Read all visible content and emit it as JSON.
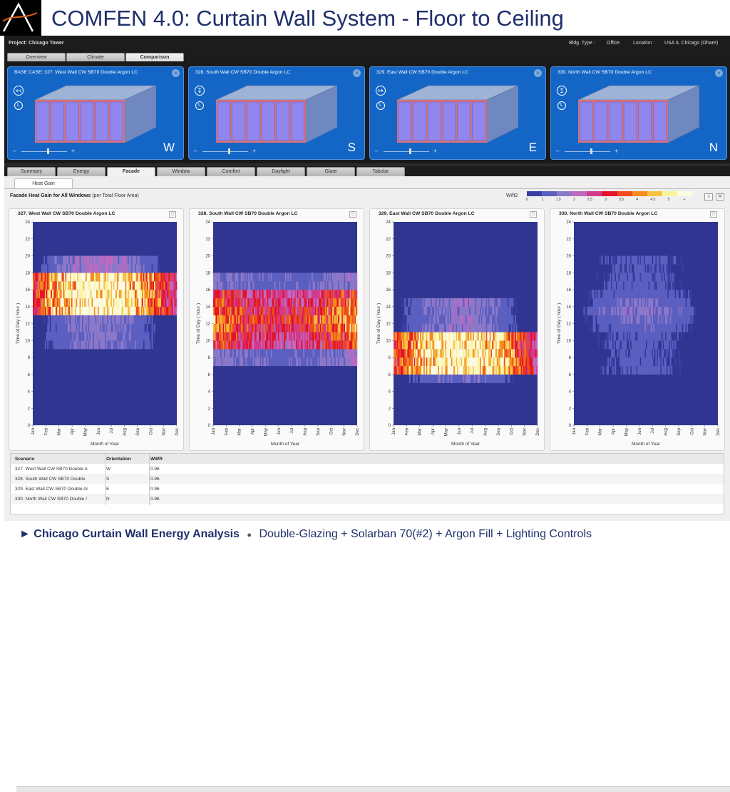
{
  "slide_title": "COMFEN 4.0:  Curtain Wall System - Floor to Ceiling",
  "project_bar": {
    "project": "Project: Chicago Tower",
    "bldg_type_label": "Bldg. Type :",
    "bldg_type_value": "Office",
    "location_label": "Location :",
    "location_value": "USA IL Chicago (Ohare)"
  },
  "top_tabs": [
    "Overview",
    "Climate",
    "Comparison"
  ],
  "cards": [
    {
      "title": "BASE CASE: 327. West Wall CW SB70 Double Argon LC",
      "orientation": "W"
    },
    {
      "title": "328. South Wall CW SB70 Double Argon LC",
      "orientation": "S"
    },
    {
      "title": "329. East Wall CW SB70 Double Argon LC",
      "orientation": "E"
    },
    {
      "title": "330. North Wall CW SB70 Double Argon LC",
      "orientation": "N"
    }
  ],
  "card_controls": {
    "compass_l": "L",
    "zoom_minus": "–",
    "zoom_plus": "+",
    "close": "×"
  },
  "sub_tabs": [
    "Summary",
    "Energy",
    "Facade",
    "Window",
    "Comfort",
    "Daylight",
    "Glare",
    "Tabular"
  ],
  "active_sub_tab": "Facade",
  "heat_gain_tab": "Heat Gain",
  "heading_bold": "Facade Heat Gain for All Windows",
  "heading_rest": "(per Total Floor Area)",
  "legend": {
    "unit": "W/ft2",
    "ticks": [
      "0",
      "1",
      "1.5",
      "2",
      "2.5",
      "3",
      "3.5",
      "4",
      "4.5",
      "5",
      "+"
    ],
    "colors": [
      "#3a3fa6",
      "#5b5fc0",
      "#8b78c9",
      "#bf6ac2",
      "#d43a8c",
      "#e5132b",
      "#ef4d1d",
      "#f58a1f",
      "#f7c144",
      "#fbf3a0",
      "#fdfbe0"
    ]
  },
  "chart_data": [
    {
      "type": "heatmap",
      "title": "327. West Wall CW SB70 Double Argon LC",
      "xlabel": "Month of Year",
      "ylabel": "Time of Day ( hour )",
      "x_categories": [
        "Jan",
        "Feb",
        "Mar",
        "Apr",
        "May",
        "Jun",
        "Jul",
        "Aug",
        "Sep",
        "Oct",
        "Nov",
        "Dec"
      ],
      "y_ticks": [
        0,
        2,
        4,
        6,
        8,
        10,
        12,
        14,
        16,
        18,
        20,
        24,
        22
      ],
      "ylim": [
        0,
        24
      ],
      "peak_hours": [
        14,
        17
      ],
      "orientation": "W"
    },
    {
      "type": "heatmap",
      "title": "328. South Wall CW SB70 Double Argon LC",
      "xlabel": "Month of Year",
      "ylabel": "Time of Day ( hour )",
      "x_categories": [
        "Jan",
        "Feb",
        "Mar",
        "Apr",
        "May",
        "Jun",
        "Jul",
        "Aug",
        "Sep",
        "Oct",
        "Nov",
        "Dec"
      ],
      "y_ticks": [
        0,
        2,
        4,
        6,
        8,
        10,
        12,
        14,
        16,
        18,
        20,
        22,
        24
      ],
      "ylim": [
        0,
        24
      ],
      "peak_hours": [
        9,
        15
      ],
      "orientation": "S"
    },
    {
      "type": "heatmap",
      "title": "329. East Wall CW SB70 Double Argon LC",
      "xlabel": "Month of Year",
      "ylabel": "Time of Day ( hour )",
      "x_categories": [
        "Jan",
        "Feb",
        "Mar",
        "Apr",
        "May",
        "Jun",
        "Jul",
        "Aug",
        "Sep",
        "Oct",
        "Nov",
        "Dec"
      ],
      "y_ticks": [
        0,
        2,
        4,
        6,
        8,
        10,
        12,
        14,
        16,
        18,
        20,
        22,
        24
      ],
      "ylim": [
        0,
        24
      ],
      "peak_hours": [
        6,
        10
      ],
      "orientation": "E"
    },
    {
      "type": "heatmap",
      "title": "330. North Wall CW SB70 Double Argon LC",
      "xlabel": "Month of Year",
      "ylabel": "Time of Day ( hour )",
      "x_categories": [
        "Jan",
        "Feb",
        "Mar",
        "Apr",
        "May",
        "Jun",
        "Jul",
        "Aug",
        "Sep",
        "Oct",
        "Nov",
        "Dec"
      ],
      "y_ticks": [
        0,
        2,
        4,
        6,
        8,
        10,
        12,
        14,
        16,
        18,
        20,
        22,
        24
      ],
      "ylim": [
        0,
        24
      ],
      "peak_hours": [
        10,
        17
      ],
      "orientation": "N"
    }
  ],
  "table": {
    "headers": [
      "Scenario",
      "Orientation",
      "WWR"
    ],
    "rows": [
      [
        "327. West Wall CW SB70 Double A",
        "W",
        "0.96"
      ],
      [
        "328. South Wall CW SB70 Double",
        "S",
        "0.96"
      ],
      [
        "329. East Wall CW SB70 Double Ar",
        "E",
        "0.96"
      ],
      [
        "330. North Wall CW SB70 Double /",
        "N",
        "0.96"
      ]
    ]
  },
  "footer": {
    "bold": "► Chicago Curtain Wall Energy Analysis",
    "sep": "●",
    "rest": "Double-Glazing + Solarban 70(#2) + Argon Fill + Lighting Controls"
  }
}
